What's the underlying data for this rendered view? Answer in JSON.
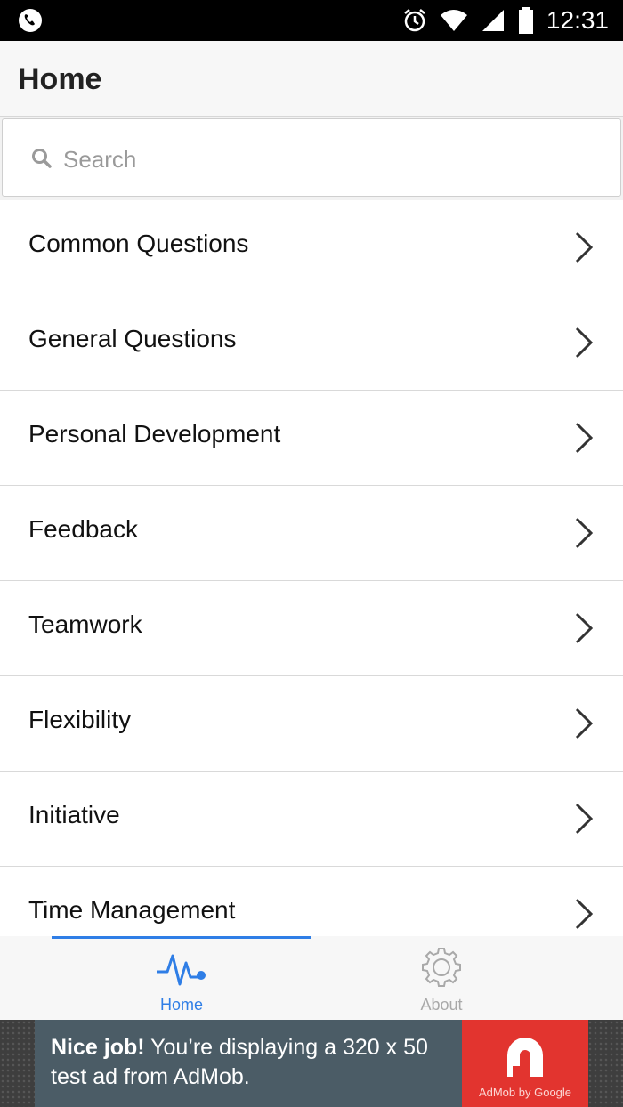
{
  "status_bar": {
    "time": "12:31",
    "icons": [
      "phone-icon",
      "alarm-icon",
      "wifi-icon",
      "signal-icon",
      "battery-icon"
    ]
  },
  "app_bar": {
    "title": "Home"
  },
  "search": {
    "placeholder": "Search",
    "icon": "search-icon"
  },
  "list": {
    "items": [
      {
        "label": "Common Questions"
      },
      {
        "label": "General Questions"
      },
      {
        "label": "Personal Development"
      },
      {
        "label": "Feedback"
      },
      {
        "label": "Teamwork"
      },
      {
        "label": "Flexibility"
      },
      {
        "label": "Initiative"
      },
      {
        "label": "Time Management"
      }
    ],
    "chevron_icon": "chevron-right-icon"
  },
  "tabs": {
    "home": {
      "label": "Home",
      "icon": "pulse-icon",
      "color": "#2f7ee6",
      "active": true
    },
    "about": {
      "label": "About",
      "icon": "gear-icon",
      "color": "#a9a9a9",
      "active": false
    }
  },
  "ad": {
    "headline_bold": "Nice job!",
    "headline_rest": " You’re displaying a 320 x 50 test ad from AdMob.",
    "brand": "AdMob by Google",
    "accent": "#e2342f"
  }
}
